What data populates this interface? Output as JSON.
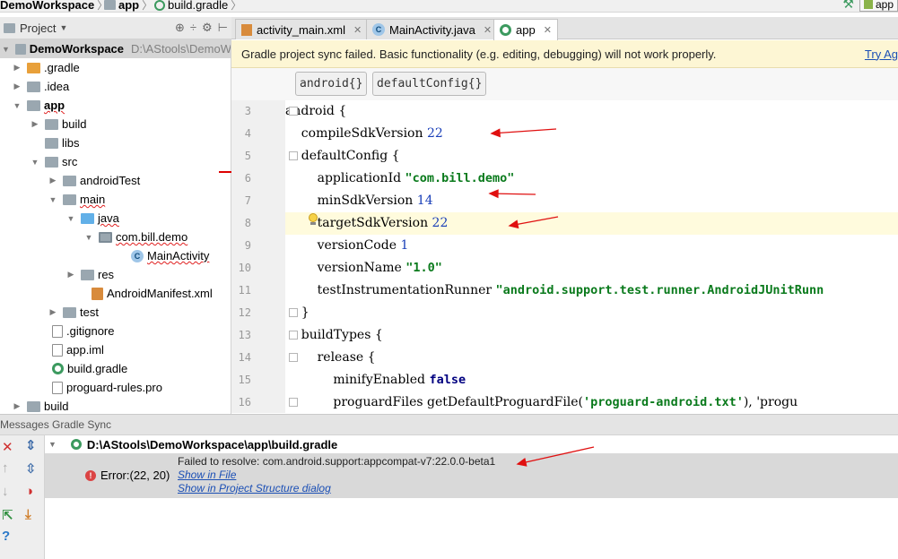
{
  "navbar": {
    "crumbs": [
      "DemoWorkspace",
      "app",
      "build.gradle"
    ],
    "run_config": "app"
  },
  "project": {
    "header_label": "Project",
    "tree": [
      {
        "label": "DemoWorkspace",
        "path": "D:\\AStools\\DemoW",
        "bold": true
      },
      {
        "label": ".gradle"
      },
      {
        "label": ".idea"
      },
      {
        "label": "app"
      },
      {
        "label": "build"
      },
      {
        "label": "libs"
      },
      {
        "label": "src"
      },
      {
        "label": "androidTest"
      },
      {
        "label": "main"
      },
      {
        "label": "java"
      },
      {
        "label": "com.bill.demo"
      },
      {
        "label": "MainActivity"
      },
      {
        "label": "res"
      },
      {
        "label": "AndroidManifest.xml"
      },
      {
        "label": "test"
      },
      {
        "label": ".gitignore"
      },
      {
        "label": "app.iml"
      },
      {
        "label": "build.gradle"
      },
      {
        "label": "proguard-rules.pro"
      },
      {
        "label": "build"
      }
    ]
  },
  "editor": {
    "tabs": [
      {
        "label": "activity_main.xml",
        "active": false
      },
      {
        "label": "MainActivity.java",
        "active": false
      },
      {
        "label": "app",
        "active": true
      }
    ],
    "banner_message": "Gradle project sync failed. Basic functionality (e.g. editing, debugging) will not work properly.",
    "banner_action": "Try Ag",
    "breadcrumbs": [
      "android{}",
      "defaultConfig{}"
    ],
    "lines": [
      {
        "num": "3",
        "pre": "android {",
        "val": "",
        "post": ""
      },
      {
        "num": "4",
        "pre": "    compileSdkVersion ",
        "val": "22",
        "post": ""
      },
      {
        "num": "5",
        "pre": "    defaultConfig {",
        "val": "",
        "post": ""
      },
      {
        "num": "6",
        "pre": "        applicationId ",
        "val": "\"com.bill.demo\"",
        "post": ""
      },
      {
        "num": "7",
        "pre": "        minSdkVersion ",
        "val": "14",
        "post": ""
      },
      {
        "num": "8",
        "pre": "        targetSdkVersion ",
        "val": "22",
        "post": ""
      },
      {
        "num": "9",
        "pre": "        versionCode ",
        "val": "1",
        "post": ""
      },
      {
        "num": "10",
        "pre": "        versionName ",
        "val": "\"1.0\"",
        "post": ""
      },
      {
        "num": "11",
        "pre": "        testInstrumentationRunner ",
        "val": "\"android.support.test.runner.AndroidJUnitRunn",
        "post": ""
      },
      {
        "num": "12",
        "pre": "    }",
        "val": "",
        "post": ""
      },
      {
        "num": "13",
        "pre": "    buildTypes {",
        "val": "",
        "post": ""
      },
      {
        "num": "14",
        "pre": "        release {",
        "val": "",
        "post": ""
      },
      {
        "num": "15",
        "pre": "            minifyEnabled ",
        "val": "false",
        "post": ""
      },
      {
        "num": "16",
        "pre": "            proguardFiles getDefaultProguardFile(",
        "val": "'proguard-android.txt'",
        "post": "), 'progu"
      }
    ]
  },
  "messages": {
    "header": "Messages Gradle Sync",
    "file": "D:\\AStools\\DemoWorkspace\\app\\build.gradle",
    "error_label": "Error:(22, 20)",
    "error_message": "Failed to resolve: com.android.support:appcompat-v7:22.0.0-beta1",
    "link_show_in_file": "Show in File",
    "link_project_structure": "Show in Project Structure dialog"
  },
  "colors": {
    "annotation_arrow": "#e01010",
    "banner_bg": "#fdf6d4",
    "number": "#1a3fb8",
    "string": "#0a7a1c"
  }
}
